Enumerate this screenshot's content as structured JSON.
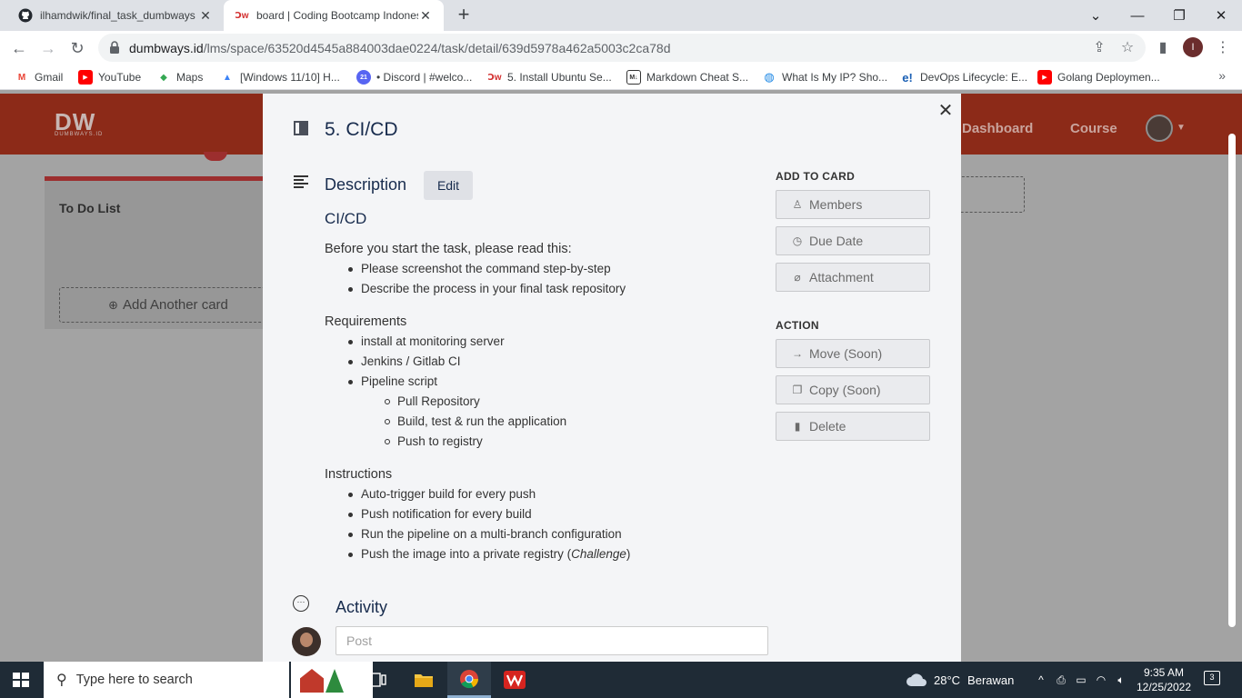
{
  "browser": {
    "tabs": [
      {
        "title": "ilhamdwik/final_task_dumbways",
        "favicon": "github-icon"
      },
      {
        "title": "board | Coding Bootcamp Indonesia",
        "favicon": "dumbways-icon"
      }
    ],
    "url_host": "dumbways.id",
    "url_path": "/lms/space/63520d4545a884003dae0224/task/detail/639d5978a462a5003c2ca78d",
    "profile_initial": "I",
    "bookmarks": [
      {
        "label": "Gmail",
        "icon": "gmail-icon",
        "color": "#ea4335",
        "glyph": "M"
      },
      {
        "label": "YouTube",
        "icon": "youtube-icon",
        "color": "#ff0000",
        "glyph": "▶"
      },
      {
        "label": "Maps",
        "icon": "maps-icon",
        "color": "#34a853",
        "glyph": "◆"
      },
      {
        "label": "[Windows 11/10] H...",
        "icon": "windows-guide-icon",
        "color": "#3b82f6",
        "glyph": "▲"
      },
      {
        "label": "• Discord | #welco...",
        "icon": "discord-icon",
        "color": "#5865f2",
        "glyph": "21"
      },
      {
        "label": "5. Install Ubuntu Se...",
        "icon": "dumbways-icon",
        "color": "#d32f2f",
        "glyph": "Ↄw"
      },
      {
        "label": "Markdown Cheat S...",
        "icon": "markdown-icon",
        "color": "#333333",
        "glyph": "M↓"
      },
      {
        "label": "What Is My IP? Sho...",
        "icon": "globe-icon",
        "color": "#1e88e5",
        "glyph": "◍"
      },
      {
        "label": "DevOps Lifecycle: E...",
        "icon": "edureka-icon",
        "color": "#1a5fb4",
        "glyph": "e!"
      },
      {
        "label": "Golang Deploymen...",
        "icon": "youtube-icon",
        "color": "#ff0000",
        "glyph": "▶"
      }
    ]
  },
  "site": {
    "logo_text": "DW",
    "logo_sub": "DUMBWAYS.ID",
    "nav": [
      "Dashboard",
      "Course"
    ],
    "column_title": "To Do List",
    "add_card_label": "Add Another card"
  },
  "modal": {
    "title": "5. CI/CD",
    "description_heading": "Description",
    "edit_label": "Edit",
    "content_heading": "CI/CD",
    "intro": "Before you start the task, please read this:",
    "intro_items": [
      "Please screenshot the command step-by-step",
      "Describe the process in your final task repository"
    ],
    "requirements_heading": "Requirements",
    "requirements": [
      "install at monitoring server",
      "Jenkins / Gitlab CI",
      "Pipeline script"
    ],
    "pipeline_items": [
      "Pull Repository",
      "Build, test & run the application",
      "Push to registry"
    ],
    "instructions_heading": "Instructions",
    "instructions": [
      "Auto-trigger build for every push",
      "Push notification for every build",
      "Run the pipeline on a multi-branch configuration",
      "Push the image into a private registry"
    ],
    "instruction_challenge": "Challenge",
    "add_to_card_heading": "ADD TO CARD",
    "add_to_card": [
      {
        "label": "Members",
        "icon": "user-icon"
      },
      {
        "label": "Due Date",
        "icon": "clock-icon"
      },
      {
        "label": "Attachment",
        "icon": "paperclip-icon"
      }
    ],
    "action_heading": "ACTION",
    "actions": [
      {
        "label": "Move (Soon)",
        "icon": "arrow-right-icon"
      },
      {
        "label": "Copy (Soon)",
        "icon": "copy-icon"
      },
      {
        "label": "Delete",
        "icon": "trash-icon"
      }
    ],
    "activity_heading": "Activity",
    "post_placeholder": "Post"
  },
  "taskbar": {
    "search_placeholder": "Type here to search",
    "temperature": "28°C",
    "weather": "Berawan",
    "time": "9:35 AM",
    "date": "12/25/2022",
    "notification_count": "3"
  }
}
